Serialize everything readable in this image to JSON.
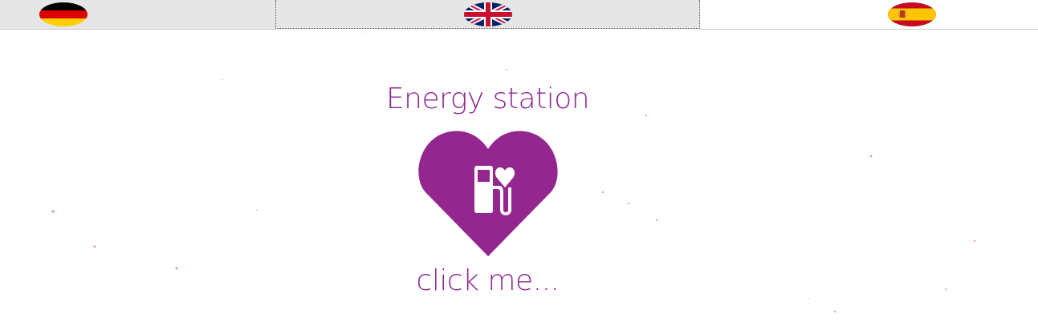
{
  "languages": [
    {
      "code": "de",
      "flag_icon": "germany-flag-icon"
    },
    {
      "code": "en",
      "flag_icon": "uk-flag-icon",
      "selected": true
    },
    {
      "code": "es",
      "flag_icon": "spain-flag-icon"
    }
  ],
  "main": {
    "title": "Energy station",
    "logo_icon": "heart-fuel-pump-icon",
    "cta_label": "click me..."
  },
  "colors": {
    "accent": "#93278f",
    "tab_bg": "#e6e6e6",
    "sparkle": "#e58ad1"
  }
}
